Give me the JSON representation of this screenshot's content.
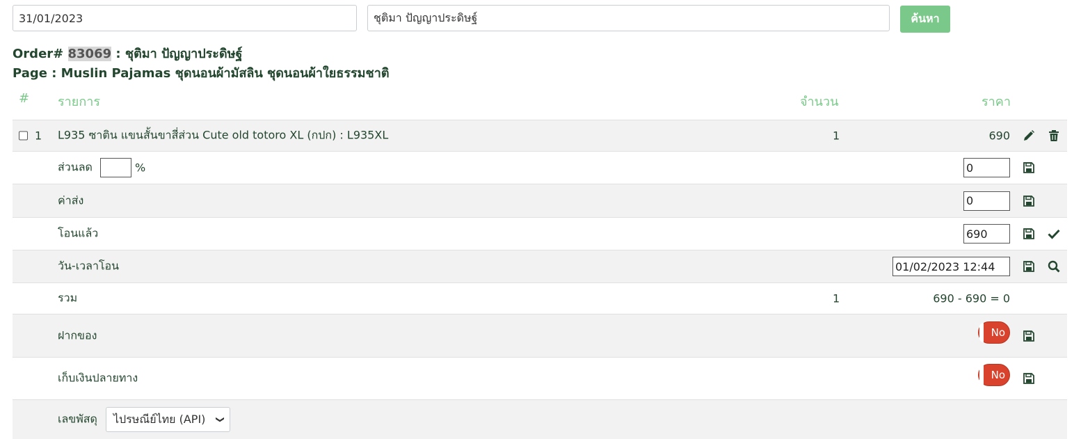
{
  "search": {
    "date_value": "31/01/2023",
    "name_value": "ชุติมา ปัญญาประดิษฐ์",
    "button_label": "ค้นหา"
  },
  "order": {
    "prefix": "Order# ",
    "id": "83069",
    "customer": " : ชุติมา ปัญญาประดิษฐ์",
    "page_line": "Page : Muslin Pajamas ชุดนอนผ้ามัสลิน ชุดนอนผ้าใยธรรมชาติ"
  },
  "table": {
    "headers": {
      "num": "#",
      "item": "รายการ",
      "qty": "จำนวน",
      "price": "ราคา"
    },
    "items": [
      {
        "num": "1",
        "name": "L935 ซาติน แขนสั้นขาสี่ส่วน Cute old totoro XL (กปก) : L935XL",
        "qty": "1",
        "price": "690"
      }
    ],
    "discount": {
      "label": "ส่วนลด",
      "percent_value": "",
      "percent_sign": "%",
      "value": "0"
    },
    "shipping": {
      "label": "ค่าส่ง",
      "value": "0"
    },
    "paid": {
      "label": "โอนแล้ว",
      "value": "690"
    },
    "transfer_time": {
      "label": "วัน-เวลาโอน",
      "value": "01/02/2023 12:44"
    },
    "total": {
      "label": "รวม",
      "qty": "1",
      "value": "690 - 690 = 0"
    },
    "deposit": {
      "label": "ฝากของ",
      "toggle": "No"
    },
    "cod": {
      "label": "เก็บเงินปลายทาง",
      "toggle": "No"
    },
    "tracking": {
      "label": "เลขพัสดุ",
      "carrier": "ไปรษณีย์ไทย (API)"
    }
  },
  "colors": {
    "accent": "#7bc98a",
    "text": "#23462e",
    "toggle_off": "#d9422c",
    "row_alt": "#f2f2f2"
  },
  "icons": [
    "pencil-icon",
    "trash-icon",
    "save-icon",
    "check-icon",
    "search-icon",
    "chevron-down-icon"
  ]
}
